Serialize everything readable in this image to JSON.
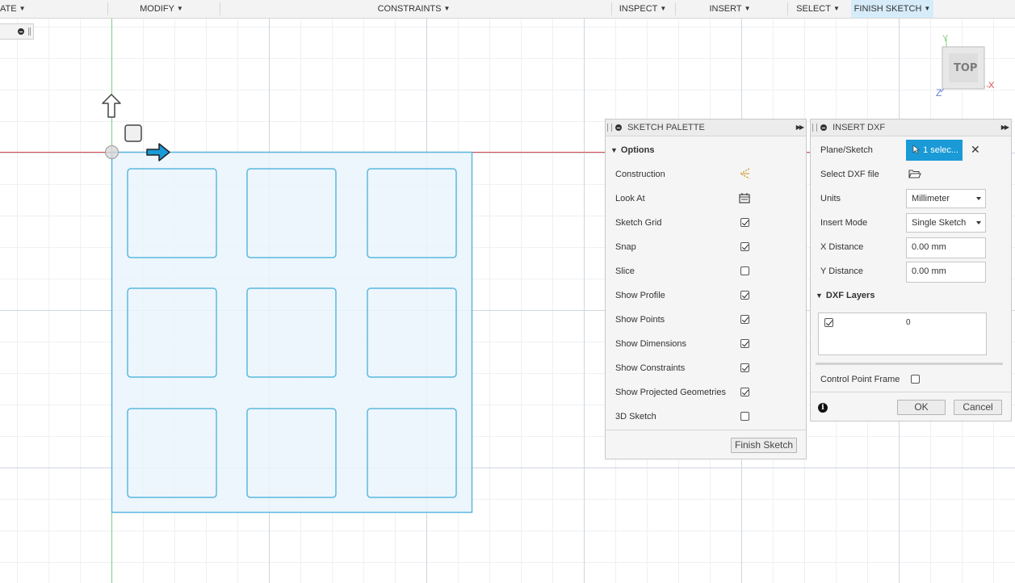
{
  "toolbar": {
    "items": [
      {
        "label": "ATE"
      },
      {
        "label": "MODIFY"
      },
      {
        "label": "CONSTRAINTS"
      },
      {
        "label": "INSPECT"
      },
      {
        "label": "INSERT"
      },
      {
        "label": "SELECT"
      },
      {
        "label": "FINISH SKETCH"
      }
    ]
  },
  "viewcube": {
    "face_label": "TOP",
    "axis_x": "X",
    "axis_y": "Y",
    "axis_z": "Z"
  },
  "sketch_palette": {
    "title": "SKETCH PALETTE",
    "section": "Options",
    "options": [
      {
        "label": "Construction",
        "type": "icon",
        "icon": "construction-icon"
      },
      {
        "label": "Look At",
        "type": "icon",
        "icon": "look-at-icon"
      },
      {
        "label": "Sketch Grid",
        "type": "checkbox",
        "checked": true
      },
      {
        "label": "Snap",
        "type": "checkbox",
        "checked": true
      },
      {
        "label": "Slice",
        "type": "checkbox",
        "checked": false
      },
      {
        "label": "Show Profile",
        "type": "checkbox",
        "checked": true
      },
      {
        "label": "Show Points",
        "type": "checkbox",
        "checked": true
      },
      {
        "label": "Show Dimensions",
        "type": "checkbox",
        "checked": true
      },
      {
        "label": "Show Constraints",
        "type": "checkbox",
        "checked": true
      },
      {
        "label": "Show Projected Geometries",
        "type": "checkbox",
        "checked": true
      },
      {
        "label": "3D Sketch",
        "type": "checkbox",
        "checked": false
      }
    ],
    "finish_button": "Finish Sketch"
  },
  "insert_dxf": {
    "title": "INSERT DXF",
    "plane_label": "Plane/Sketch",
    "plane_value": "1 selec...",
    "file_label": "Select DXF file",
    "units_label": "Units",
    "units_value": "Millimeter",
    "mode_label": "Insert Mode",
    "mode_value": "Single Sketch",
    "x_label": "X Distance",
    "x_value": "0.00 mm",
    "y_label": "Y Distance",
    "y_value": "0.00 mm",
    "layers_title": "DXF Layers",
    "layers": [
      {
        "name": "0",
        "checked": true
      }
    ],
    "control_point_label": "Control Point Frame",
    "control_point_checked": false,
    "ok_label": "OK",
    "cancel_label": "Cancel"
  },
  "colors": {
    "accent": "#1a9ad6",
    "sketch_line": "#5ab8e0",
    "sketch_fill": "#eaf5fc",
    "x_axis": "#e05050",
    "y_axis": "#7ed07e",
    "z_axis": "#6a7fd8"
  }
}
